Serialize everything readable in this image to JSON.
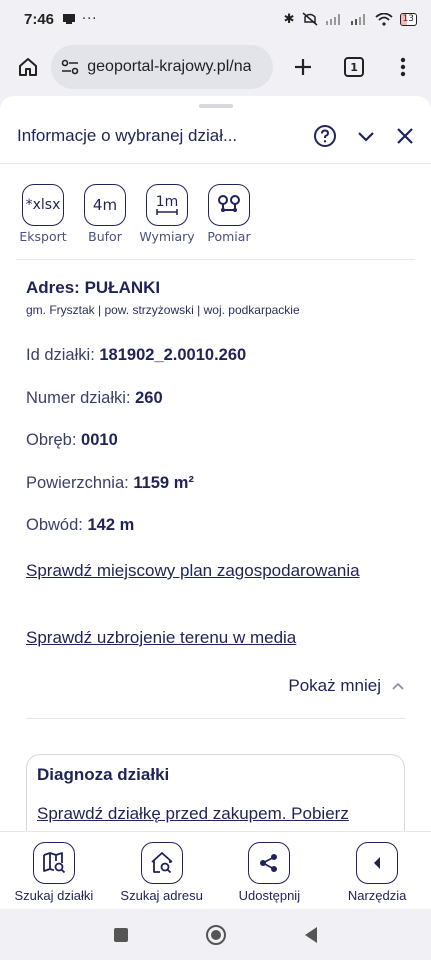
{
  "status_bar": {
    "time": "7:46",
    "battery": "13"
  },
  "browser": {
    "url": "geoportal-krajowy.pl/na",
    "tab_count": "1"
  },
  "sheet": {
    "title": "Informacje o wybranej dział...",
    "tools": [
      {
        "icon_text": "*xlsx",
        "label": "Eksport"
      },
      {
        "icon_text": "4m",
        "label": "Bufor"
      },
      {
        "icon_text": "1m",
        "label": "Wymiary"
      },
      {
        "icon_text": "",
        "label": "Pomiar"
      }
    ],
    "address": {
      "title": "Adres: PUŁANKI",
      "subtitle": "gm. Frysztak | pow. strzyżowski | woj. podkarpackie"
    },
    "fields": [
      {
        "label": "Id działki:",
        "value": "181902_2.0010.260"
      },
      {
        "label": "Numer działki:",
        "value": "260"
      },
      {
        "label": "Obręb:",
        "value": "0010"
      },
      {
        "label": "Powierzchnia:",
        "value": "1159 m²"
      },
      {
        "label": "Obwód:",
        "value": "142 m"
      }
    ],
    "links": {
      "plan": "Sprawdź miejscowy plan zagospodarowania",
      "media": "Sprawdź uzbrojenie terenu w media"
    },
    "toggle_label": "Pokaż mniej",
    "diagnosis": {
      "title": "Diagnoza działki",
      "text": "Sprawdź działkę przed zakupem. Pobierz"
    }
  },
  "bottom_nav": [
    {
      "label": "Szukaj działki",
      "icon": "map-search-icon"
    },
    {
      "label": "Szukaj adresu",
      "icon": "home-search-icon"
    },
    {
      "label": "Udostępnij",
      "icon": "share-icon"
    },
    {
      "label": "Narzędzia",
      "icon": "chevron-left-icon"
    }
  ],
  "colors": {
    "primary": "#1f2358",
    "border": "#e6e6ec",
    "background": "#f1f1f5"
  }
}
